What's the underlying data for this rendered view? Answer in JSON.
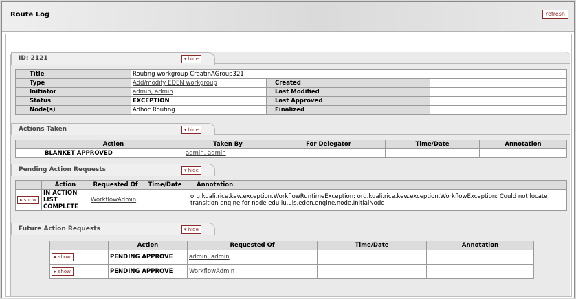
{
  "header": {
    "title": "Route Log",
    "refresh_label": "refresh"
  },
  "id_section": {
    "title": "ID: 2121",
    "hide_label": "▾ hide",
    "rows": [
      {
        "label": "Title",
        "value": "Routing workgroup CreatinAGroup321"
      },
      {
        "label": "Type",
        "value": "Add/modify EDEN workgroup",
        "label2": "Created",
        "value2": ""
      },
      {
        "label": "Initiator",
        "value": "admin, admin",
        "label2": "Last Modified",
        "value2": ""
      },
      {
        "label": "Status",
        "value": "EXCEPTION",
        "label2": "Last Approved",
        "value2": ""
      },
      {
        "label": "Node(s)",
        "value": "Adhoc Routing",
        "label2": "Finalized",
        "value2": ""
      }
    ]
  },
  "actions_taken": {
    "title": "Actions Taken",
    "hide_label": "▾ hide",
    "columns": [
      "Action",
      "Taken By",
      "For Delegator",
      "Time/Date",
      "Annotation"
    ],
    "rows": [
      {
        "action": "BLANKET APPROVED",
        "taken_by": "admin, admin",
        "for_delegator": "",
        "time": "",
        "annotation": ""
      }
    ]
  },
  "pending": {
    "title": "Pending Action Requests",
    "hide_label": "▾ hide",
    "columns": [
      "Action",
      "Requested Of",
      "Time/Date",
      "Annotation"
    ],
    "rows": [
      {
        "show_label": "▸ show",
        "action": "IN ACTION LIST COMPLETE",
        "requested_of": "WorkflowAdmin",
        "time": "",
        "annotation": "org.kuali.rice.kew.exception.WorkflowRuntimeException: org.kuali.rice.kew.exception.WorkflowException: Could not locate transition engine for node edu.iu.uis.eden.engine.node.InitialNode"
      }
    ]
  },
  "future": {
    "title": "Future Action Requests",
    "hide_label": "▾ hide",
    "columns": [
      "Action",
      "Requested Of",
      "Time/Date",
      "Annotation"
    ],
    "rows": [
      {
        "show_label": "▸ show",
        "action": "PENDING APPROVE",
        "requested_of": "admin, admin",
        "time": "",
        "annotation": ""
      },
      {
        "show_label": "▸ show",
        "action": "PENDING APPROVE",
        "requested_of": "WorkflowAdmin",
        "time": "",
        "annotation": ""
      }
    ]
  }
}
